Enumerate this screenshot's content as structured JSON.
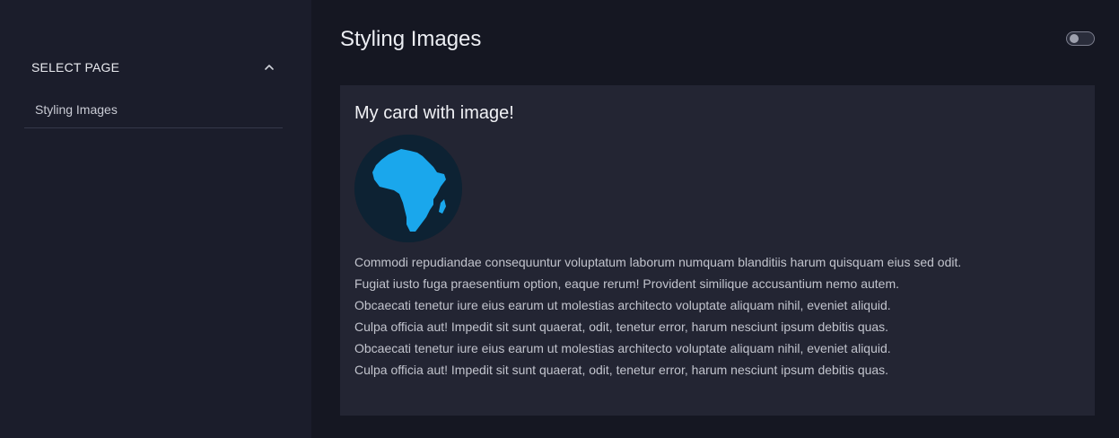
{
  "sidebar": {
    "section_title": "SELECT PAGE",
    "items": [
      {
        "label": "Styling Images"
      }
    ]
  },
  "main": {
    "title": "Styling Images",
    "theme_toggle": {
      "state": "off"
    },
    "card": {
      "title": "My card with image!",
      "image_icon": "africa-globe",
      "paragraphs": [
        "Commodi repudiandae consequuntur voluptatum laborum numquam blanditiis harum quisquam eius sed odit.",
        "Fugiat iusto fuga praesentium option, eaque rerum! Provident similique accusantium nemo autem.",
        "Obcaecati tenetur iure eius earum ut molestias architecto voluptate aliquam nihil, eveniet aliquid.",
        "Culpa officia aut! Impedit sit sunt quaerat, odit, tenetur error, harum nesciunt ipsum debitis quas.",
        "Obcaecati tenetur iure eius earum ut molestias architecto voluptate aliquam nihil, eveniet aliquid.",
        "Culpa officia aut! Impedit sit sunt quaerat, odit, tenetur error, harum nesciunt ipsum debitis quas."
      ]
    }
  },
  "colors": {
    "background": "#151722",
    "sidebar": "#1b1d2b",
    "card": "#232533",
    "accent": "#1aa7ec"
  }
}
